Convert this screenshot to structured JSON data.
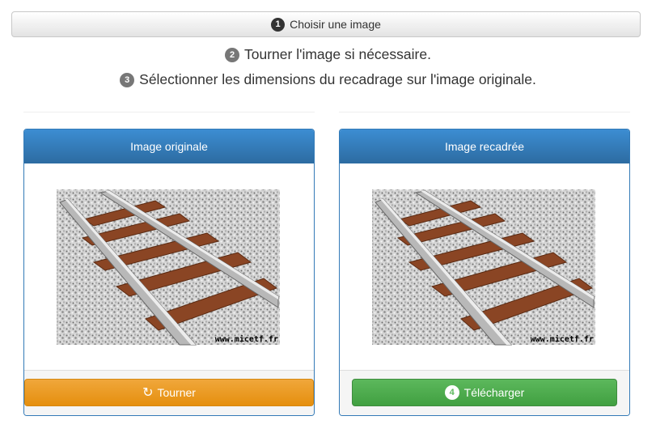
{
  "toolbar": {
    "step1_badge": "1",
    "choose_label": "Choisir une image"
  },
  "steps": [
    {
      "badge": "2",
      "text": "Tourner l'image si nécessaire."
    },
    {
      "badge": "3",
      "text": "Sélectionner les dimensions du recadrage sur l'image originale."
    }
  ],
  "panels": {
    "original": {
      "title": "Image originale",
      "watermark": "www.micetf.fr",
      "rotate_label": "Tourner",
      "rotate_icon": "refresh-icon"
    },
    "cropped": {
      "title": "Image recadrée",
      "watermark": "www.micetf.fr",
      "download_badge": "4",
      "download_label": "Télécharger"
    }
  },
  "colors": {
    "primary": "#337ab7",
    "warning": "#f0ad4e",
    "success": "#5cb85c"
  }
}
